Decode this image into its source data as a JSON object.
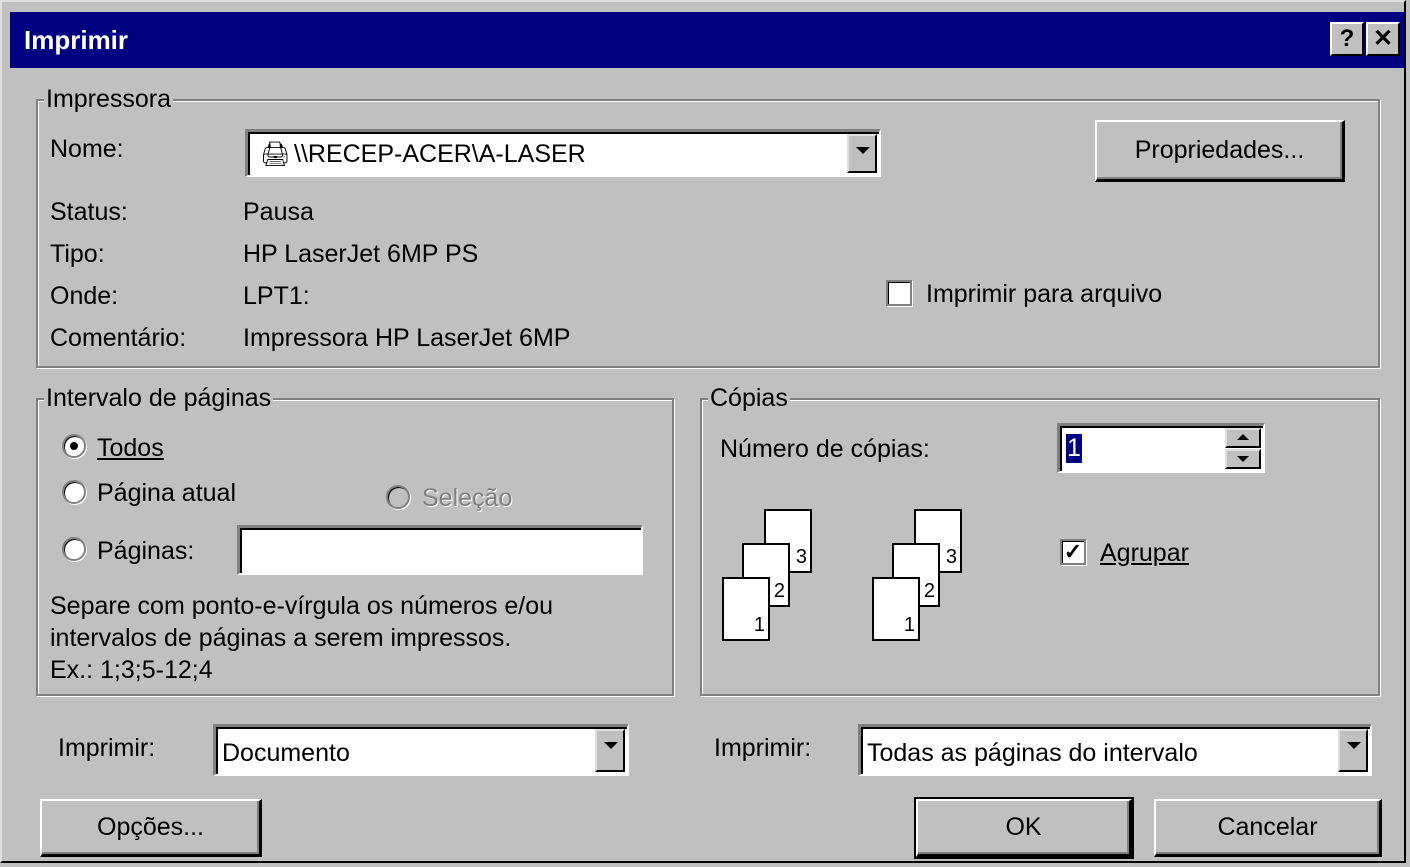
{
  "title": "Imprimir",
  "title_buttons": {
    "help": "?",
    "close": "✕"
  },
  "printer": {
    "group_label": "Impressora",
    "name_label": "Nome:",
    "name_value": "\\\\RECEP-ACER\\A-LASER",
    "properties_button": "Propriedades...",
    "status_label": "Status:",
    "status_value": "Pausa",
    "type_label": "Tipo:",
    "type_value": "HP LaserJet 6MP PS",
    "where_label": "Onde:",
    "where_value": "LPT1:",
    "comment_label": "Comentário:",
    "comment_value": "Impressora HP LaserJet 6MP",
    "print_to_file_label": "Imprimir para arquivo",
    "print_to_file_checked": false
  },
  "range": {
    "group_label": "Intervalo de páginas",
    "all_label": "Todos",
    "current_label": "Página atual",
    "selection_label": "Seleção",
    "pages_label": "Páginas:",
    "pages_value": "",
    "help_line1": "Separe com ponto-e-vírgula os números e/ou",
    "help_line2": "intervalos de páginas a serem impressos.",
    "help_line3": "Ex.: 1;3;5-12;4",
    "selected": "all"
  },
  "copies": {
    "group_label": "Cópias",
    "number_label": "Número de cópias:",
    "number_value": "1",
    "collate_label": "Agrupar",
    "collate_checked": true,
    "page_numbers": [
      "1",
      "2",
      "3"
    ]
  },
  "print_what": {
    "label": "Imprimir:",
    "value": "Documento"
  },
  "print_range": {
    "label": "Imprimir:",
    "value": "Todas as páginas do intervalo"
  },
  "buttons": {
    "options": "Opções...",
    "ok": "OK",
    "cancel": "Cancelar"
  }
}
